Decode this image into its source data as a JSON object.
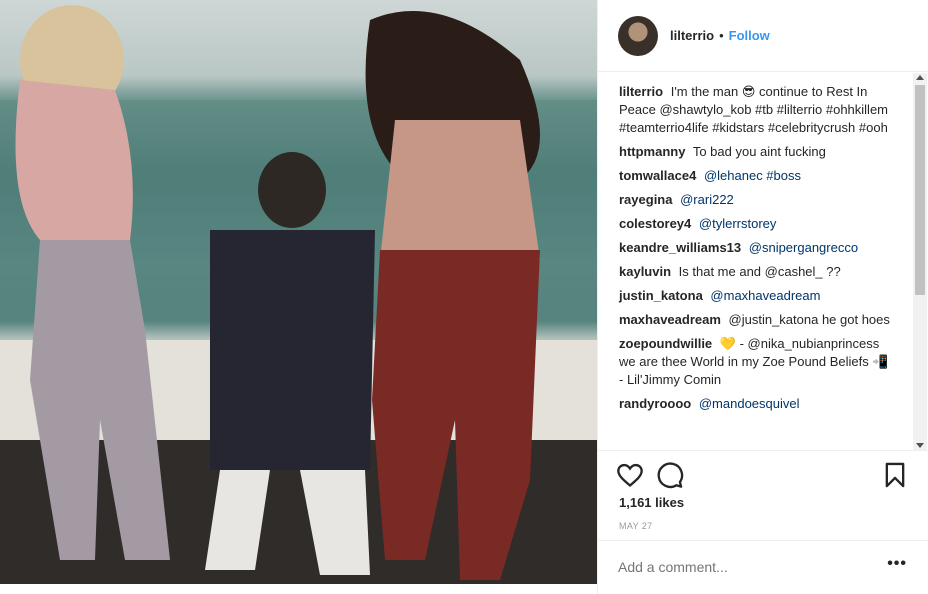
{
  "post": {
    "username": "lilterrio",
    "separator": "•",
    "follow_label": "Follow"
  },
  "comments": [
    {
      "user": "lilterrio",
      "text": "I'm the man 😎 continue to Rest In Peace @shawtylo_kob #tb #lilterrio #ohhkillem #teamterrio4life #kidstars #celebritycrush #ooh"
    },
    {
      "user": "httpmanny",
      "text": "To bad you aint fucking"
    },
    {
      "user": "tomwallace4",
      "text": "@lehanec #boss"
    },
    {
      "user": "rayegina",
      "text": "@rari222"
    },
    {
      "user": "colestorey4",
      "text": "@tylerrstorey"
    },
    {
      "user": "keandre_williams13",
      "text": "@snipergangrecco"
    },
    {
      "user": "kayluvin",
      "text": "Is that me and @cashel_ ??"
    },
    {
      "user": "justin_katona",
      "text": "@maxhaveadream"
    },
    {
      "user": "maxhaveadream",
      "text": "@justin_katona he got hoes"
    },
    {
      "user": "zoepoundwillie",
      "text": "💛 - @nika_nubianprincess we are thee World in my Zoe Pound Beliefs 📲 - Lil'Jimmy Comin"
    },
    {
      "user": "randyroooo",
      "text": "@mandoesquivel"
    }
  ],
  "likes": "1,161 likes",
  "date": "MAY 27",
  "add_comment_placeholder": "Add a comment...",
  "more_label": "•••",
  "icons": {
    "like": "heart-icon",
    "comment": "comment-icon",
    "save": "bookmark-icon",
    "more": "more-options-icon"
  },
  "colors": {
    "link": "#3897f0",
    "mention": "#003569",
    "text": "#262626",
    "muted": "#999999"
  }
}
